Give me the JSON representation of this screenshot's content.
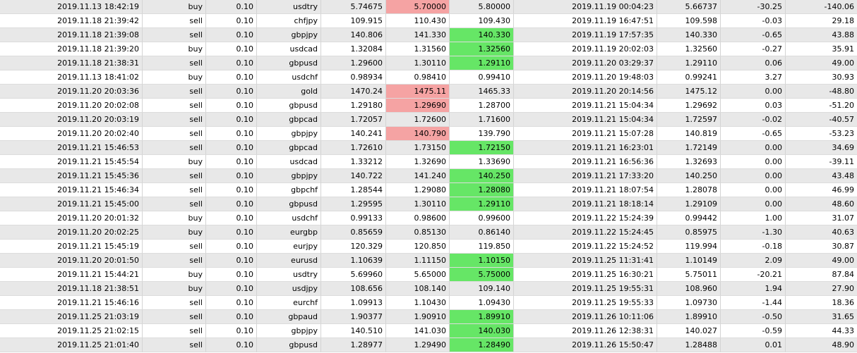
{
  "colors": {
    "row_alt": "#e8e8e8",
    "row_base": "#ffffff",
    "highlight_red": "#f5a3a3",
    "highlight_green": "#66e666"
  },
  "rows": [
    {
      "open_time": "2019.11.13 18:42:19",
      "type": "buy",
      "size": "0.10",
      "symbol": "usdtry",
      "open_price": "5.74675",
      "sl": "5.70000",
      "sl_hl": "red",
      "tp": "5.80000",
      "tp_hl": "",
      "close_time": "2019.11.19 00:04:23",
      "close_price": "5.66737",
      "swap": "-30.25",
      "profit": "-140.06"
    },
    {
      "open_time": "2019.11.18 21:39:42",
      "type": "sell",
      "size": "0.10",
      "symbol": "chfjpy",
      "open_price": "109.915",
      "sl": "110.430",
      "sl_hl": "",
      "tp": "109.430",
      "tp_hl": "",
      "close_time": "2019.11.19 16:47:51",
      "close_price": "109.598",
      "swap": "-0.03",
      "profit": "29.18"
    },
    {
      "open_time": "2019.11.18 21:39:08",
      "type": "sell",
      "size": "0.10",
      "symbol": "gbpjpy",
      "open_price": "140.806",
      "sl": "141.330",
      "sl_hl": "",
      "tp": "140.330",
      "tp_hl": "green",
      "close_time": "2019.11.19 17:57:35",
      "close_price": "140.330",
      "swap": "-0.65",
      "profit": "43.88"
    },
    {
      "open_time": "2019.11.18 21:39:20",
      "type": "buy",
      "size": "0.10",
      "symbol": "usdcad",
      "open_price": "1.32084",
      "sl": "1.31560",
      "sl_hl": "",
      "tp": "1.32560",
      "tp_hl": "green",
      "close_time": "2019.11.19 20:02:03",
      "close_price": "1.32560",
      "swap": "-0.27",
      "profit": "35.91"
    },
    {
      "open_time": "2019.11.18 21:38:31",
      "type": "sell",
      "size": "0.10",
      "symbol": "gbpusd",
      "open_price": "1.29600",
      "sl": "1.30110",
      "sl_hl": "",
      "tp": "1.29110",
      "tp_hl": "green",
      "close_time": "2019.11.20 03:29:37",
      "close_price": "1.29110",
      "swap": "0.06",
      "profit": "49.00"
    },
    {
      "open_time": "2019.11.13 18:41:02",
      "type": "buy",
      "size": "0.10",
      "symbol": "usdchf",
      "open_price": "0.98934",
      "sl": "0.98410",
      "sl_hl": "",
      "tp": "0.99410",
      "tp_hl": "",
      "close_time": "2019.11.20 19:48:03",
      "close_price": "0.99241",
      "swap": "3.27",
      "profit": "30.93"
    },
    {
      "open_time": "2019.11.20 20:03:36",
      "type": "sell",
      "size": "0.10",
      "symbol": "gold",
      "open_price": "1470.24",
      "sl": "1475.11",
      "sl_hl": "red",
      "tp": "1465.33",
      "tp_hl": "",
      "close_time": "2019.11.20 20:14:56",
      "close_price": "1475.12",
      "swap": "0.00",
      "profit": "-48.80"
    },
    {
      "open_time": "2019.11.20 20:02:08",
      "type": "sell",
      "size": "0.10",
      "symbol": "gbpusd",
      "open_price": "1.29180",
      "sl": "1.29690",
      "sl_hl": "red",
      "tp": "1.28700",
      "tp_hl": "",
      "close_time": "2019.11.21 15:04:34",
      "close_price": "1.29692",
      "swap": "0.03",
      "profit": "-51.20"
    },
    {
      "open_time": "2019.11.20 20:03:19",
      "type": "sell",
      "size": "0.10",
      "symbol": "gbpcad",
      "open_price": "1.72057",
      "sl": "1.72600",
      "sl_hl": "",
      "tp": "1.71600",
      "tp_hl": "",
      "close_time": "2019.11.21 15:04:34",
      "close_price": "1.72597",
      "swap": "-0.02",
      "profit": "-40.57"
    },
    {
      "open_time": "2019.11.20 20:02:40",
      "type": "sell",
      "size": "0.10",
      "symbol": "gbpjpy",
      "open_price": "140.241",
      "sl": "140.790",
      "sl_hl": "red",
      "tp": "139.790",
      "tp_hl": "",
      "close_time": "2019.11.21 15:07:28",
      "close_price": "140.819",
      "swap": "-0.65",
      "profit": "-53.23"
    },
    {
      "open_time": "2019.11.21 15:46:53",
      "type": "sell",
      "size": "0.10",
      "symbol": "gbpcad",
      "open_price": "1.72610",
      "sl": "1.73150",
      "sl_hl": "",
      "tp": "1.72150",
      "tp_hl": "green",
      "close_time": "2019.11.21 16:23:01",
      "close_price": "1.72149",
      "swap": "0.00",
      "profit": "34.69"
    },
    {
      "open_time": "2019.11.21 15:45:54",
      "type": "buy",
      "size": "0.10",
      "symbol": "usdcad",
      "open_price": "1.33212",
      "sl": "1.32690",
      "sl_hl": "",
      "tp": "1.33690",
      "tp_hl": "",
      "close_time": "2019.11.21 16:56:36",
      "close_price": "1.32693",
      "swap": "0.00",
      "profit": "-39.11"
    },
    {
      "open_time": "2019.11.21 15:45:36",
      "type": "sell",
      "size": "0.10",
      "symbol": "gbpjpy",
      "open_price": "140.722",
      "sl": "141.240",
      "sl_hl": "",
      "tp": "140.250",
      "tp_hl": "green",
      "close_time": "2019.11.21 17:33:20",
      "close_price": "140.250",
      "swap": "0.00",
      "profit": "43.48"
    },
    {
      "open_time": "2019.11.21 15:46:34",
      "type": "sell",
      "size": "0.10",
      "symbol": "gbpchf",
      "open_price": "1.28544",
      "sl": "1.29080",
      "sl_hl": "",
      "tp": "1.28080",
      "tp_hl": "green",
      "close_time": "2019.11.21 18:07:54",
      "close_price": "1.28078",
      "swap": "0.00",
      "profit": "46.99"
    },
    {
      "open_time": "2019.11.21 15:45:00",
      "type": "sell",
      "size": "0.10",
      "symbol": "gbpusd",
      "open_price": "1.29595",
      "sl": "1.30110",
      "sl_hl": "",
      "tp": "1.29110",
      "tp_hl": "green",
      "close_time": "2019.11.21 18:18:14",
      "close_price": "1.29109",
      "swap": "0.00",
      "profit": "48.60"
    },
    {
      "open_time": "2019.11.20 20:01:32",
      "type": "buy",
      "size": "0.10",
      "symbol": "usdchf",
      "open_price": "0.99133",
      "sl": "0.98600",
      "sl_hl": "",
      "tp": "0.99600",
      "tp_hl": "",
      "close_time": "2019.11.22 15:24:39",
      "close_price": "0.99442",
      "swap": "1.00",
      "profit": "31.07"
    },
    {
      "open_time": "2019.11.20 20:02:25",
      "type": "buy",
      "size": "0.10",
      "symbol": "eurgbp",
      "open_price": "0.85659",
      "sl": "0.85130",
      "sl_hl": "",
      "tp": "0.86140",
      "tp_hl": "",
      "close_time": "2019.11.22 15:24:45",
      "close_price": "0.85975",
      "swap": "-1.30",
      "profit": "40.63"
    },
    {
      "open_time": "2019.11.21 15:45:19",
      "type": "sell",
      "size": "0.10",
      "symbol": "eurjpy",
      "open_price": "120.329",
      "sl": "120.850",
      "sl_hl": "",
      "tp": "119.850",
      "tp_hl": "",
      "close_time": "2019.11.22 15:24:52",
      "close_price": "119.994",
      "swap": "-0.18",
      "profit": "30.87"
    },
    {
      "open_time": "2019.11.20 20:01:50",
      "type": "sell",
      "size": "0.10",
      "symbol": "eurusd",
      "open_price": "1.10639",
      "sl": "1.11150",
      "sl_hl": "",
      "tp": "1.10150",
      "tp_hl": "green",
      "close_time": "2019.11.25 11:31:41",
      "close_price": "1.10149",
      "swap": "2.09",
      "profit": "49.00"
    },
    {
      "open_time": "2019.11.21 15:44:21",
      "type": "buy",
      "size": "0.10",
      "symbol": "usdtry",
      "open_price": "5.69960",
      "sl": "5.65000",
      "sl_hl": "",
      "tp": "5.75000",
      "tp_hl": "green",
      "close_time": "2019.11.25 16:30:21",
      "close_price": "5.75011",
      "swap": "-20.21",
      "profit": "87.84"
    },
    {
      "open_time": "2019.11.18 21:38:51",
      "type": "buy",
      "size": "0.10",
      "symbol": "usdjpy",
      "open_price": "108.656",
      "sl": "108.140",
      "sl_hl": "",
      "tp": "109.140",
      "tp_hl": "",
      "close_time": "2019.11.25 19:55:31",
      "close_price": "108.960",
      "swap": "1.94",
      "profit": "27.90"
    },
    {
      "open_time": "2019.11.21 15:46:16",
      "type": "sell",
      "size": "0.10",
      "symbol": "eurchf",
      "open_price": "1.09913",
      "sl": "1.10430",
      "sl_hl": "",
      "tp": "1.09430",
      "tp_hl": "",
      "close_time": "2019.11.25 19:55:33",
      "close_price": "1.09730",
      "swap": "-1.44",
      "profit": "18.36"
    },
    {
      "open_time": "2019.11.25 21:03:19",
      "type": "sell",
      "size": "0.10",
      "symbol": "gbpaud",
      "open_price": "1.90377",
      "sl": "1.90910",
      "sl_hl": "",
      "tp": "1.89910",
      "tp_hl": "green",
      "close_time": "2019.11.26 10:11:06",
      "close_price": "1.89910",
      "swap": "-0.50",
      "profit": "31.65"
    },
    {
      "open_time": "2019.11.25 21:02:15",
      "type": "sell",
      "size": "0.10",
      "symbol": "gbpjpy",
      "open_price": "140.510",
      "sl": "141.030",
      "sl_hl": "",
      "tp": "140.030",
      "tp_hl": "green",
      "close_time": "2019.11.26 12:38:31",
      "close_price": "140.027",
      "swap": "-0.59",
      "profit": "44.33"
    },
    {
      "open_time": "2019.11.25 21:01:40",
      "type": "sell",
      "size": "0.10",
      "symbol": "gbpusd",
      "open_price": "1.28977",
      "sl": "1.29490",
      "sl_hl": "",
      "tp": "1.28490",
      "tp_hl": "green",
      "close_time": "2019.11.26 15:50:47",
      "close_price": "1.28488",
      "swap": "0.01",
      "profit": "48.90"
    }
  ]
}
